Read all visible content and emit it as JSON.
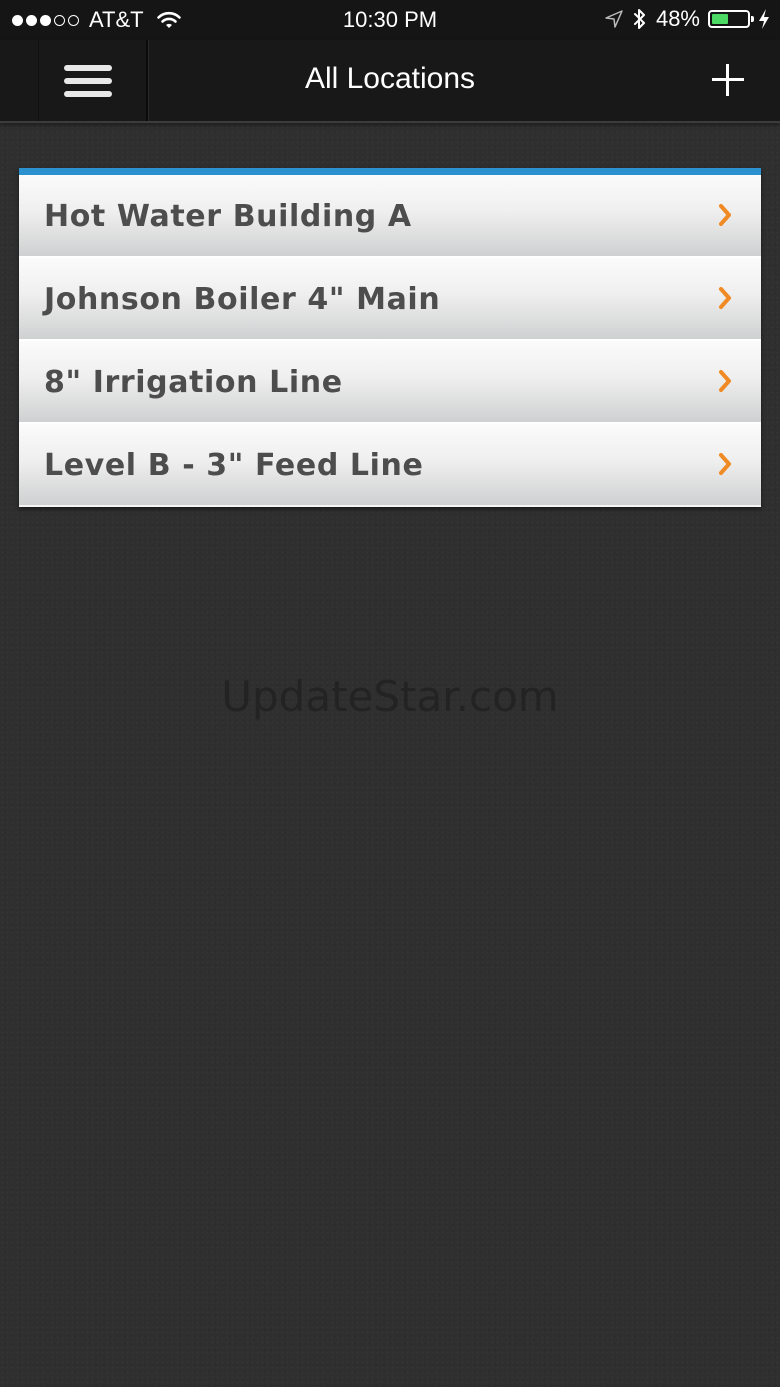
{
  "status_bar": {
    "carrier": "AT&T",
    "time": "10:30 PM",
    "battery_percent": "48%",
    "battery_level": 0.48,
    "signal_bars_total": 5,
    "signal_bars_filled": 3,
    "icons": [
      "wifi-icon",
      "location-icon",
      "bluetooth-icon",
      "battery-icon",
      "charging-icon"
    ],
    "battery_color": "#4cd964"
  },
  "nav_bar": {
    "title": "All Locations",
    "menu_icon": "hamburger-menu-icon",
    "add_icon": "plus-icon"
  },
  "locations": [
    {
      "label": "Hot Water Building A"
    },
    {
      "label": "Johnson Boiler 4\" Main"
    },
    {
      "label": "8\" Irrigation Line"
    },
    {
      "label": "Level B - 3\" Feed Line"
    }
  ],
  "watermark": "UpdateStar.com",
  "colors": {
    "accent": "#2b91cf",
    "chevron": "#f08a24",
    "item_text": "#4d4d4d"
  }
}
